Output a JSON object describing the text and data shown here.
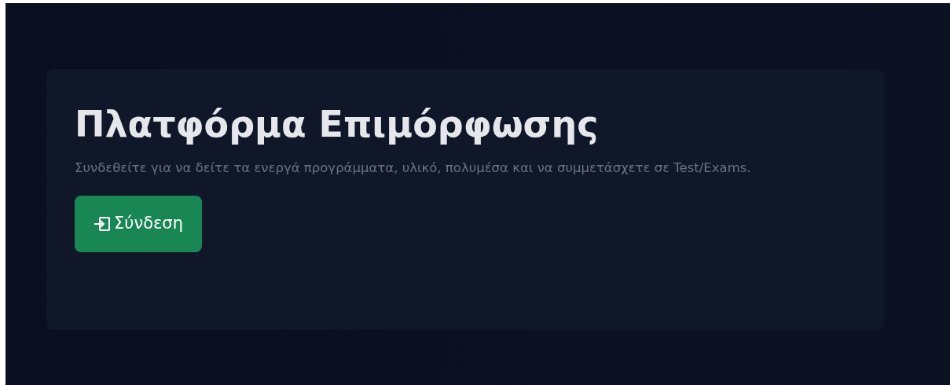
{
  "hero": {
    "title": "Πλατφόρμα Επιμόρφωσης",
    "subtitle": "Συνδεθείτε για να δείτε τα ενεργά προγράμματα, υλικό, πολυμέσα και να συμμετάσχετε σε Test/Exams.",
    "button": {
      "label": "Σύνδεση"
    }
  }
}
